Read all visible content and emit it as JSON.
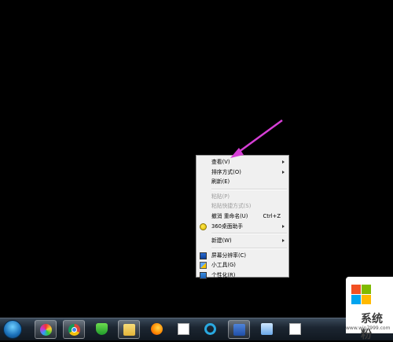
{
  "context_menu": {
    "items": [
      {
        "label": "查看(V)",
        "submenu": true,
        "disabled": false
      },
      {
        "label": "排序方式(O)",
        "submenu": true,
        "disabled": false
      },
      {
        "label": "刷新(E)",
        "submenu": false,
        "disabled": false
      },
      {
        "label": "粘贴(P)",
        "submenu": false,
        "disabled": true
      },
      {
        "label": "粘贴快捷方式(S)",
        "submenu": false,
        "disabled": true
      },
      {
        "label": "撤消 重命名(U)",
        "shortcut": "Ctrl+Z",
        "submenu": false,
        "disabled": false
      },
      {
        "label": "360桌面助手",
        "submenu": true,
        "disabled": false,
        "icon": "360-icon"
      },
      {
        "label": "新建(W)",
        "submenu": true,
        "disabled": false
      },
      {
        "label": "屏幕分辨率(C)",
        "submenu": false,
        "disabled": false,
        "icon": "screen-resolution-icon"
      },
      {
        "label": "小工具(G)",
        "submenu": false,
        "disabled": false,
        "icon": "gadgets-icon"
      },
      {
        "label": "个性化(R)",
        "submenu": false,
        "disabled": false,
        "icon": "personalize-icon"
      }
    ]
  },
  "taskbar": {
    "icons": [
      "start-orb-icon",
      "color-picker-icon",
      "chrome-icon",
      "shield-icon",
      "folder-icon",
      "firefox-icon",
      "file-icon",
      "q-browser-icon",
      "word-icon",
      "window-icon"
    ]
  },
  "watermark": {
    "brand": "系统粉",
    "url": "www.win7999.com",
    "colors": [
      "#f25022",
      "#7fba00",
      "#00a4ef",
      "#ffb900"
    ]
  },
  "colors": {
    "annotation_arrow": "#d63fd6",
    "desktop": "#000000"
  }
}
